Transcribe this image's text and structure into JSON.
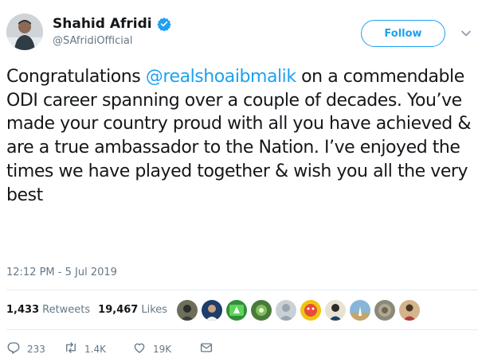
{
  "author": {
    "name": "Shahid Afridi",
    "handle": "@SAfridiOfficial",
    "verified": true
  },
  "follow_label": "Follow",
  "tweet": {
    "part1": "Congratulations ",
    "mention": "@realshoaibmalik",
    "part2": " on a commendable ODI career spanning over a couple of decades. You’ve made your country proud with all you have achieved & are a true ambassador to the Nation. I’ve enjoyed the times we have played together & wish you all the very best"
  },
  "timestamp": "12:12 PM - 5 Jul 2019",
  "stats": {
    "retweets_count": "1,433",
    "retweets_label": "Retweets",
    "likes_count": "19,467",
    "likes_label": "Likes"
  },
  "actions": {
    "replies": "233",
    "retweets": "1.4K",
    "likes": "19K"
  },
  "colors": {
    "accent": "#1da1f2",
    "text": "#14171a",
    "muted": "#657786",
    "divider": "#e6ecf0"
  },
  "icons": [
    "verified-badge-icon",
    "chevron-down-icon",
    "reply-icon",
    "retweet-icon",
    "like-icon",
    "message-icon"
  ]
}
